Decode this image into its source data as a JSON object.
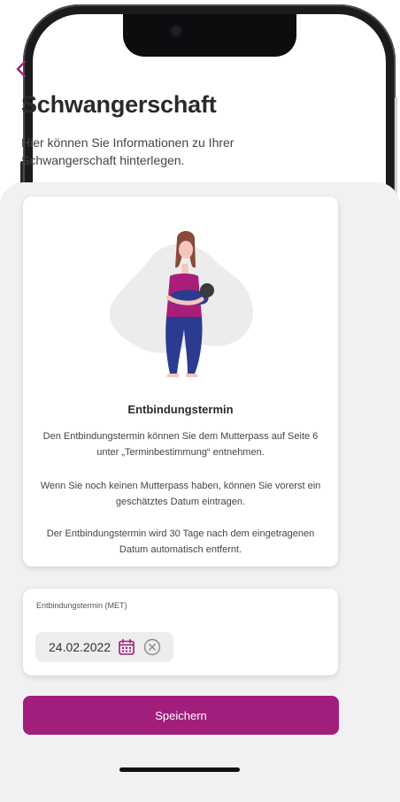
{
  "header": {
    "title": "Schwangerschaft",
    "subtitle": "Hier können Sie Informationen zu Ihrer Schwangerschaft hinterlegen."
  },
  "info_card": {
    "title": "Entbindungstermin",
    "paragraphs": [
      "Den Entbindungstermin können Sie dem Mutterpass auf Seite 6 unter „Terminbestimmung“ entnehmen.",
      "Wenn Sie noch keinen Mutterpass haben, können Sie vorerst ein geschätztes Datum eintragen.",
      "Der Entbindungstermin wird 30 Tage nach dem eingetragenen Datum automatisch entfernt."
    ]
  },
  "date_field": {
    "label": "Entbindungstermin (MET)",
    "value": "24.02.2022"
  },
  "actions": {
    "save_label": "Speichern"
  },
  "icons": {
    "back": "chevron-left-icon",
    "calendar": "calendar-icon",
    "clear": "clear-icon"
  },
  "colors": {
    "accent": "#a21e7c",
    "background": "#f1f1f3",
    "card": "#ffffff"
  }
}
